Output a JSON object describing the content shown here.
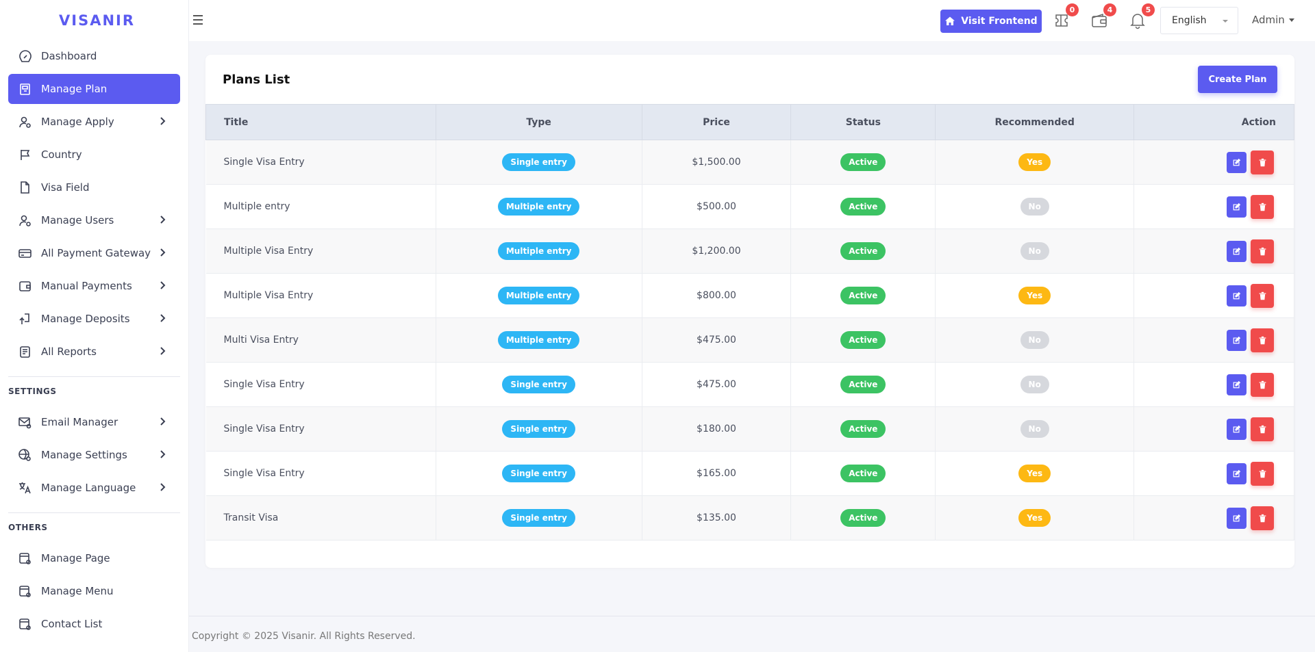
{
  "brand": "VISANIR",
  "sidebar": {
    "items": [
      {
        "label": "Dashboard",
        "icon": "dashboard-icon",
        "active": false,
        "chevron": false
      },
      {
        "label": "Manage Plan",
        "icon": "plan-icon",
        "active": true,
        "chevron": false
      },
      {
        "label": "Manage Apply",
        "icon": "user-gear-icon",
        "active": false,
        "chevron": true
      },
      {
        "label": "Country",
        "icon": "flag-icon",
        "active": false,
        "chevron": false
      },
      {
        "label": "Visa Field",
        "icon": "file-icon",
        "active": false,
        "chevron": false
      },
      {
        "label": "Manage Users",
        "icon": "user-gear-icon",
        "active": false,
        "chevron": true
      },
      {
        "label": "All Payment Gateway",
        "icon": "credit-card-icon",
        "active": false,
        "chevron": true
      },
      {
        "label": "Manual Payments",
        "icon": "wallet-icon",
        "active": false,
        "chevron": true
      },
      {
        "label": "Manage Deposits",
        "icon": "deposit-icon",
        "active": false,
        "chevron": true
      },
      {
        "label": "All Reports",
        "icon": "report-icon",
        "active": false,
        "chevron": true
      }
    ],
    "settings_title": "SETTINGS",
    "settings_items": [
      {
        "label": "Email Manager",
        "icon": "mail-gear-icon",
        "chevron": true
      },
      {
        "label": "Manage Settings",
        "icon": "globe-gear-icon",
        "chevron": true
      },
      {
        "label": "Manage Language",
        "icon": "translate-icon",
        "chevron": true
      }
    ],
    "others_title": "OTHERS",
    "others_items": [
      {
        "label": "Manage Page",
        "icon": "page-gear-icon"
      },
      {
        "label": "Manage Menu",
        "icon": "menu-gear-icon"
      },
      {
        "label": "Contact List",
        "icon": "contact-icon"
      }
    ]
  },
  "topbar": {
    "visit_label": "Visit Frontend",
    "ticket_count": "0",
    "wallet_count": "4",
    "notification_count": "5",
    "language": "English",
    "admin_label": "Admin"
  },
  "card": {
    "title": "Plans List",
    "create_label": "Create Plan"
  },
  "table": {
    "headers": {
      "title": "Title",
      "type": "Type",
      "price": "Price",
      "status": "Status",
      "recommended": "Recommended",
      "action": "Action"
    },
    "rows": [
      {
        "title": "Single Visa Entry",
        "type": "Single entry",
        "price": "$1,500.00",
        "status": "Active",
        "recommended": "Yes"
      },
      {
        "title": "Multiple entry",
        "type": "Multiple entry",
        "price": "$500.00",
        "status": "Active",
        "recommended": "No"
      },
      {
        "title": "Multiple Visa Entry",
        "type": "Multiple entry",
        "price": "$1,200.00",
        "status": "Active",
        "recommended": "No"
      },
      {
        "title": "Multiple Visa Entry",
        "type": "Multiple entry",
        "price": "$800.00",
        "status": "Active",
        "recommended": "Yes"
      },
      {
        "title": "Multi Visa Entry",
        "type": "Multiple entry",
        "price": "$475.00",
        "status": "Active",
        "recommended": "No"
      },
      {
        "title": "Single Visa Entry",
        "type": "Single entry",
        "price": "$475.00",
        "status": "Active",
        "recommended": "No"
      },
      {
        "title": "Single Visa Entry",
        "type": "Single entry",
        "price": "$180.00",
        "status": "Active",
        "recommended": "No"
      },
      {
        "title": "Single Visa Entry",
        "type": "Single entry",
        "price": "$165.00",
        "status": "Active",
        "recommended": "Yes"
      },
      {
        "title": "Transit Visa",
        "type": "Single entry",
        "price": "$135.00",
        "status": "Active",
        "recommended": "Yes"
      }
    ]
  },
  "footer": "Copyright © 2025 Visanir. All Rights Reserved.",
  "colors": {
    "accent": "#5b5bf0",
    "info": "#2db6f5",
    "success": "#3cc363",
    "warning": "#fdb813",
    "danger": "#f04b4b",
    "muted": "#d6d8dd"
  }
}
